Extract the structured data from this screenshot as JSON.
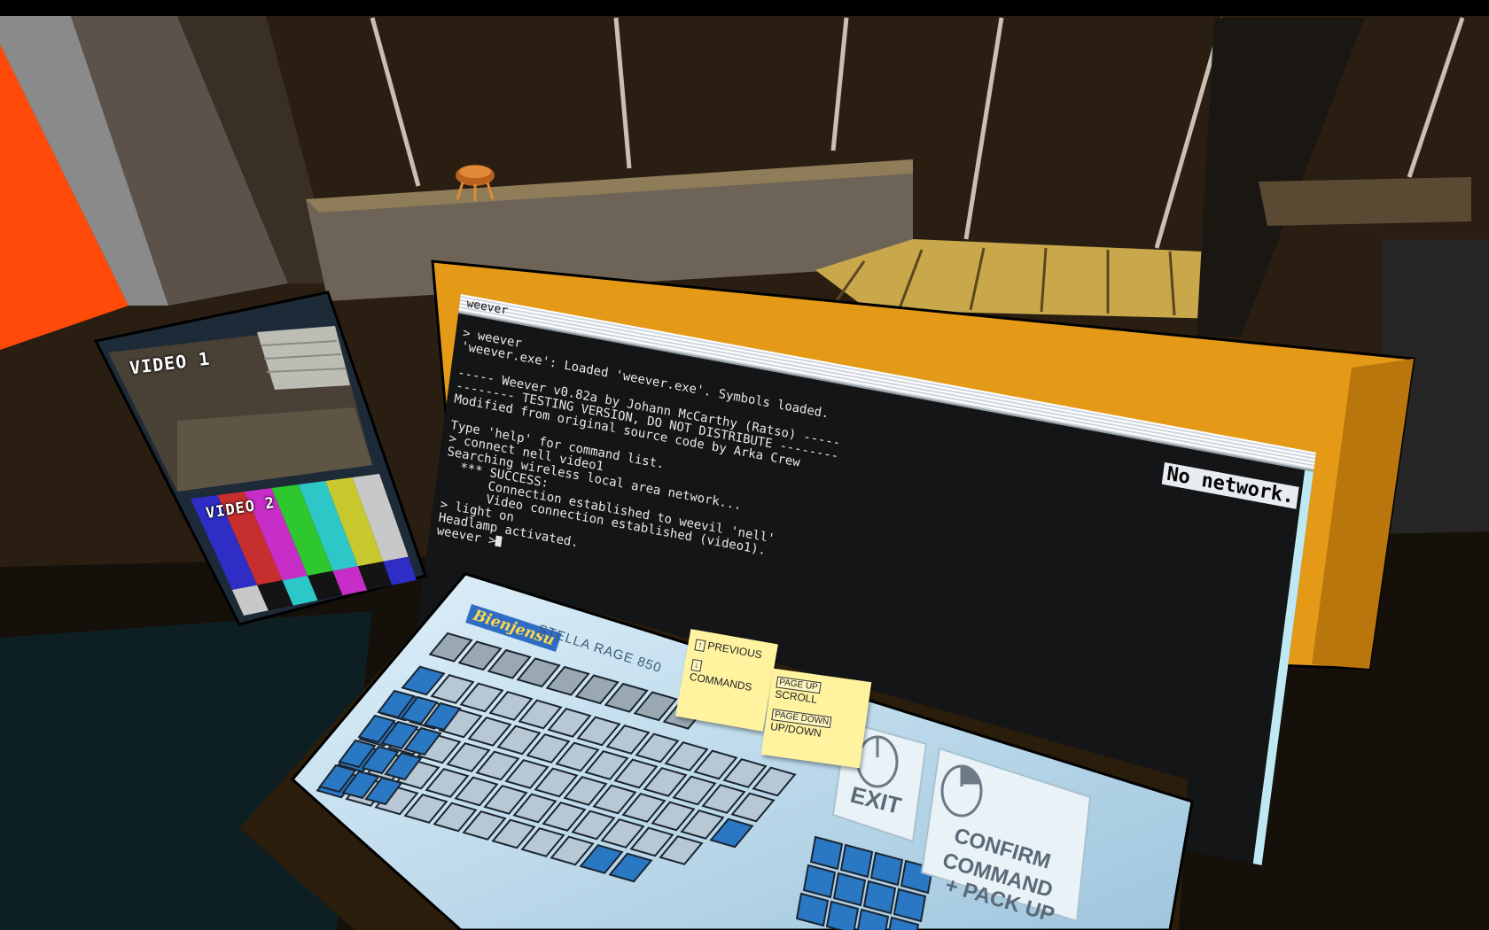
{
  "terminal": {
    "title": "weever",
    "network_status": "No network.",
    "lines": [
      "> weever",
      "'weever.exe': Loaded 'weever.exe'. Symbols loaded.",
      "",
      "----- Weever v0.82a by Johann McCarthy (Ratso) -----",
      "-------- TESTING VERSION, DO NOT DISTRIBUTE --------",
      "Modified from original source code by Arka Crew",
      "",
      "Type 'help' for command list.",
      "> connect nell video1",
      "Searching wireless local area network...",
      "  *** SUCCESS:",
      "      Connection established to weevil 'nell'",
      "      Video connection established (video1).",
      "> light on",
      "Headlamp activated.",
      ""
    ],
    "prompt": "weever >"
  },
  "keyboard": {
    "brand": "Bienjensu",
    "model": "STELLA RAGE 850",
    "note_left": {
      "up_key": "↑",
      "down_key": "↓",
      "text_line1": "PREVIOUS",
      "text_line2": "COMMANDS"
    },
    "note_right": {
      "pgup_key": "PAGE UP",
      "pgdn_key": "PAGE DOWN",
      "text_line1": "SCROLL",
      "text_line2": "UP/DOWN"
    },
    "exit_label": "EXIT",
    "confirm_label_1": "CONFIRM",
    "confirm_label_2": "COMMAND",
    "confirm_label_3": "+ PACK UP"
  },
  "video": {
    "feed1_label": "VIDEO 1",
    "feed2_label": "VIDEO 2",
    "test_bars": [
      "#c8c8c8",
      "#c7c72e",
      "#2ec7c7",
      "#2ec72e",
      "#c72ec7",
      "#c72e2e",
      "#2e2ec7"
    ],
    "test_bars_bottom": [
      "#2e2ec7",
      "#141414",
      "#c72ec7",
      "#141414",
      "#2ec7c7",
      "#141414",
      "#c8c8c8"
    ]
  },
  "colors": {
    "monitor_frame": "#e59a17",
    "keyboard_body": "#c9e3f1",
    "key_blue": "#2a78c4",
    "key_grey": "#b7c8d4",
    "sticky_note": "#fff3a0",
    "terminal_bg": "#141516"
  }
}
